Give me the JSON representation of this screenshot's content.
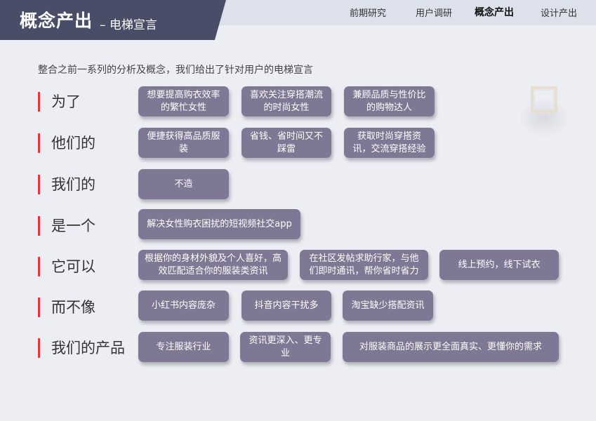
{
  "header": {
    "title": "概念产出",
    "subtitle": "– 电梯宣言",
    "nav": [
      "前期研究",
      "用户调研",
      "概念产出",
      "设计产出"
    ]
  },
  "intro": "整合之前一系列的分析及概念，我们给出了针对用户的电梯宣言",
  "rows": [
    {
      "label": "为了",
      "cards": [
        "想要提高购衣效率的繁忙女性",
        "喜欢关注穿搭潮流的时尚女性",
        "兼顾品质与性价比的购物达人"
      ]
    },
    {
      "label": "他们的",
      "cards": [
        "便捷获得高品质服装",
        "省钱、省时间又不踩雷",
        "获取时尚穿搭资讯，交流穿搭经验"
      ]
    },
    {
      "label": "我们的",
      "cards": [
        "不造"
      ]
    },
    {
      "label": "是一个",
      "cards": [
        "解决女性购衣困扰的短视频社交app"
      ]
    },
    {
      "label": "它可以",
      "cards": [
        "根据你的身材外貌及个人喜好，高效匹配适合你的服装类资讯",
        "在社区发帖求助行家，与他们即时通讯，帮你省时省力",
        "线上预约，线下试衣"
      ]
    },
    {
      "label": "而不像",
      "cards": [
        "小红书内容庞杂",
        "抖音内容干扰多",
        "淘宝缺少搭配资讯"
      ]
    },
    {
      "label": "我们的产品",
      "cards": [
        "专注服装行业",
        "资讯更深入、更专业",
        "对服装商品的展示更全面真实、更懂你的需求"
      ]
    }
  ],
  "colors": {
    "card": "#7e7894",
    "accent": "#e03a3a",
    "header": "#4a4d68"
  }
}
